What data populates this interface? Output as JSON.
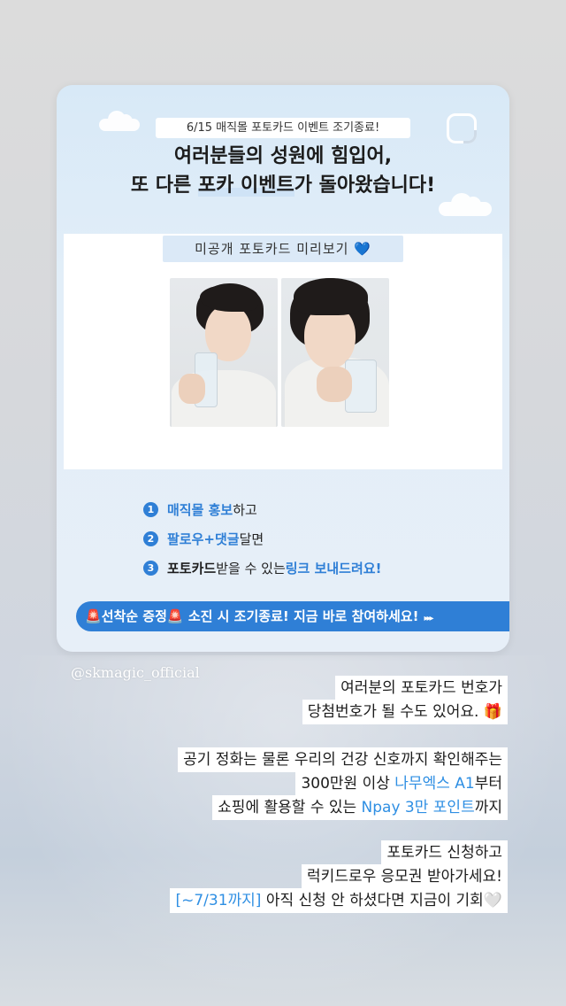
{
  "card": {
    "event_pill": "6/15 매직몰 포토카드 이벤트 조기종료!",
    "headline_line1": "여러분들의 성원에 힘입어,",
    "headline_line2_pre": "또 다른 ",
    "headline_line2_hl": "포카 이벤트",
    "headline_line2_post": "가 돌아왔습니다!",
    "preview_label": "미공개 포토카드 미리보기",
    "preview_icon": "💙",
    "steps": [
      {
        "num": "1",
        "blue": "매직몰 홍보",
        "rest": "하고"
      },
      {
        "num": "2",
        "blue": "팔로우+댓글",
        "rest": "달면"
      },
      {
        "num": "3",
        "bold": "포토카드",
        "mid": " 받을 수 있는 ",
        "blue": "링크 보내드려요!"
      }
    ],
    "cta": {
      "siren": "🚨",
      "part1": "선착순 증정",
      "part2": " 소진 시 조기종료! 지금 바로 참여하세요!",
      "arrows": "▸▸▸"
    }
  },
  "handle": "@skmagic_official",
  "caption": {
    "block1": {
      "line1": "여러분의 포토카드 번호가",
      "line2": "당첨번호가 될 수도 있어요.",
      "icon": "🎁"
    },
    "block2": {
      "line1": "공기 정화는 물론 우리의 건강 신호까지 확인해주는",
      "line2_pre": "300만원 이상 ",
      "line2_blue": "나무엑스 A1",
      "line2_post": "부터",
      "line3_pre": "쇼핑에 활용할 수 있는 ",
      "line3_blue": "Npay 3만 포인트",
      "line3_post": "까지"
    },
    "block3": {
      "line1": "포토카드 신청하고",
      "line2": "럭키드로우 응모권 받아가세요!",
      "line3_blue": "[~7/31까지]",
      "line3_post": " 아직 신청 안 하셨다면 지금이 기회",
      "icon": "🤍"
    }
  },
  "colors": {
    "accent": "#2f7fd6",
    "card_bg": "#dfecf8",
    "caption_blue": "#2f8fe3"
  }
}
